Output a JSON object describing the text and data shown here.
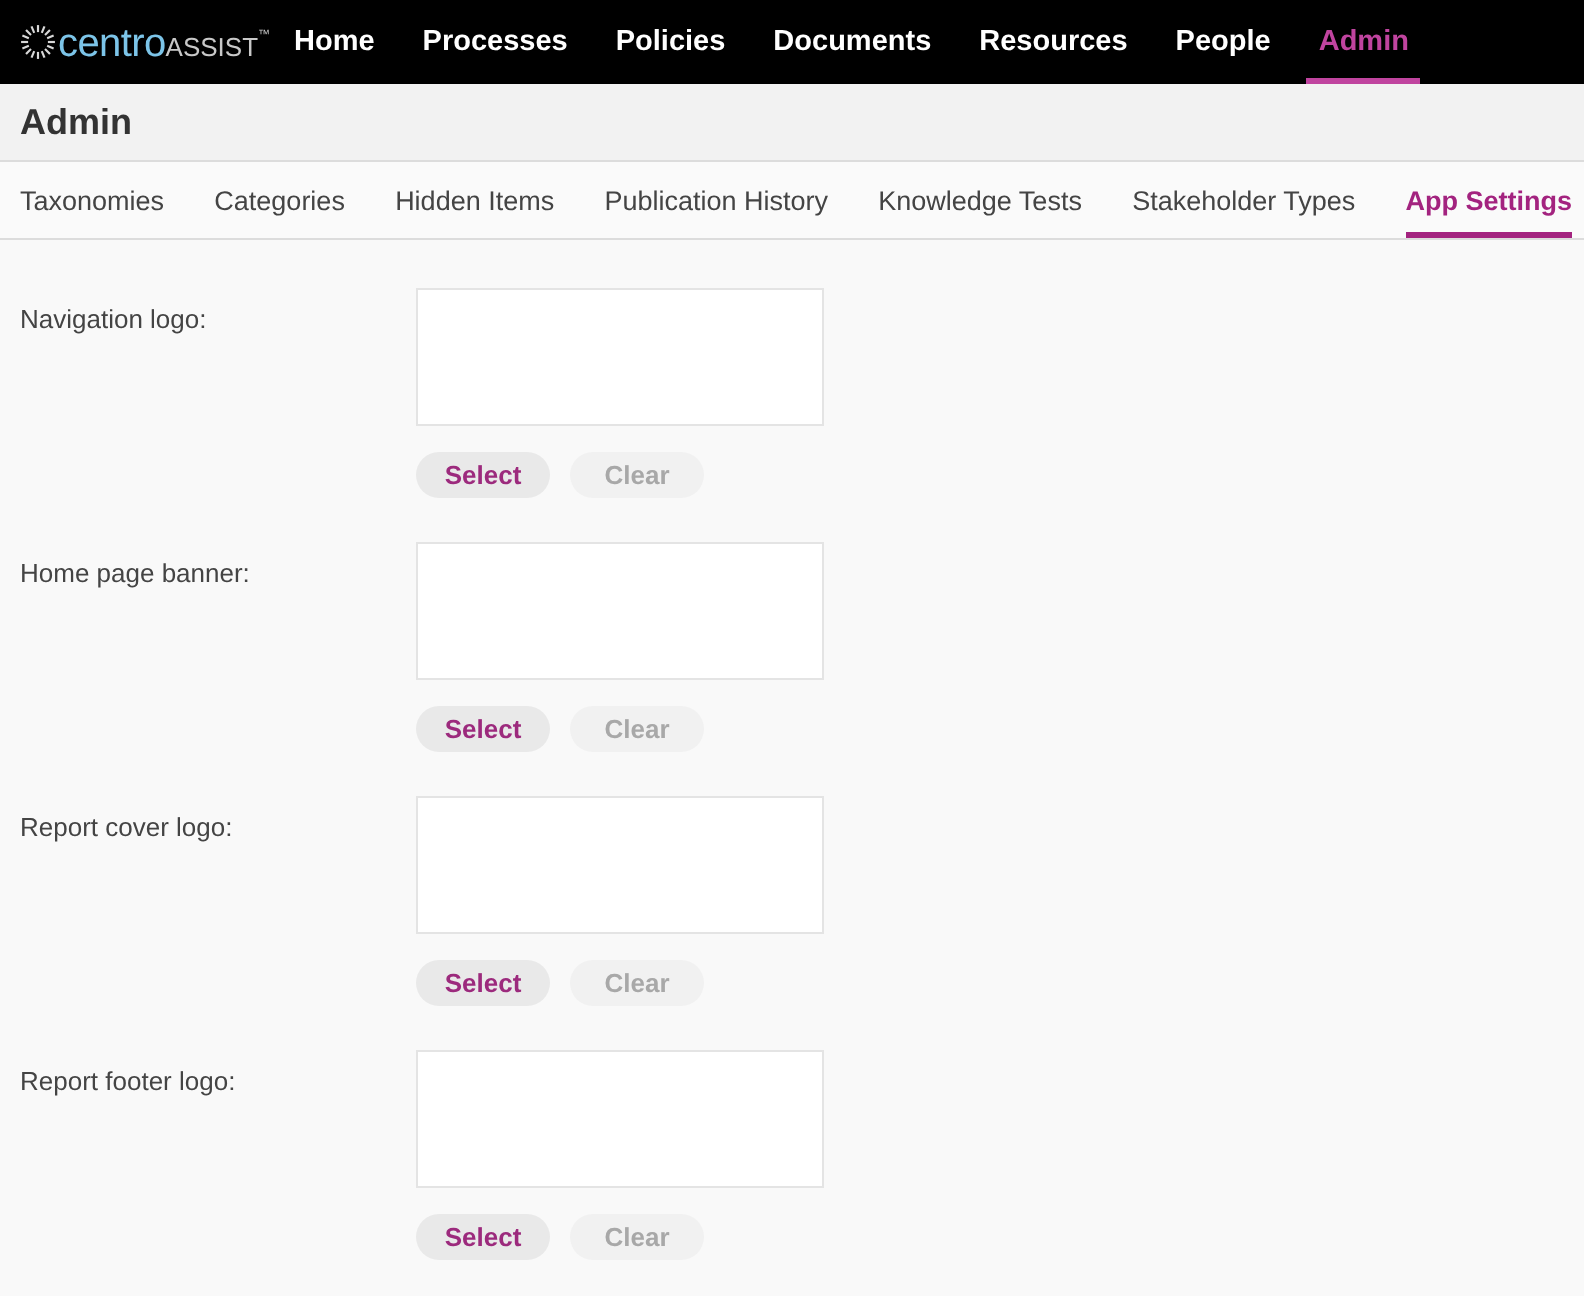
{
  "logo": {
    "primary": "centro",
    "secondary": "ASSIST",
    "trademark": "™"
  },
  "nav": [
    {
      "label": "Home",
      "selected": false
    },
    {
      "label": "Processes",
      "selected": false
    },
    {
      "label": "Policies",
      "selected": false
    },
    {
      "label": "Documents",
      "selected": false
    },
    {
      "label": "Resources",
      "selected": false
    },
    {
      "label": "People",
      "selected": false
    },
    {
      "label": "Admin",
      "selected": true
    }
  ],
  "page_title": "Admin",
  "tabs": [
    {
      "label": "Taxonomies",
      "selected": false
    },
    {
      "label": "Categories",
      "selected": false
    },
    {
      "label": "Hidden Items",
      "selected": false
    },
    {
      "label": "Publication History",
      "selected": false
    },
    {
      "label": "Knowledge Tests",
      "selected": false
    },
    {
      "label": "Stakeholder Types",
      "selected": false
    },
    {
      "label": "App Settings",
      "selected": true
    }
  ],
  "settings": [
    {
      "label": "Navigation logo:",
      "buttons": [
        {
          "label": "Select",
          "disabled": false
        },
        {
          "label": "Clear",
          "disabled": true
        }
      ]
    },
    {
      "label": "Home page banner:",
      "buttons": [
        {
          "label": "Select",
          "disabled": false
        },
        {
          "label": "Clear",
          "disabled": true
        }
      ]
    },
    {
      "label": "Report cover logo:",
      "buttons": [
        {
          "label": "Select",
          "disabled": false
        },
        {
          "label": "Clear",
          "disabled": true
        }
      ]
    },
    {
      "label": "Report footer logo:",
      "buttons": [
        {
          "label": "Select",
          "disabled": false
        },
        {
          "label": "Clear",
          "disabled": true
        }
      ]
    }
  ]
}
